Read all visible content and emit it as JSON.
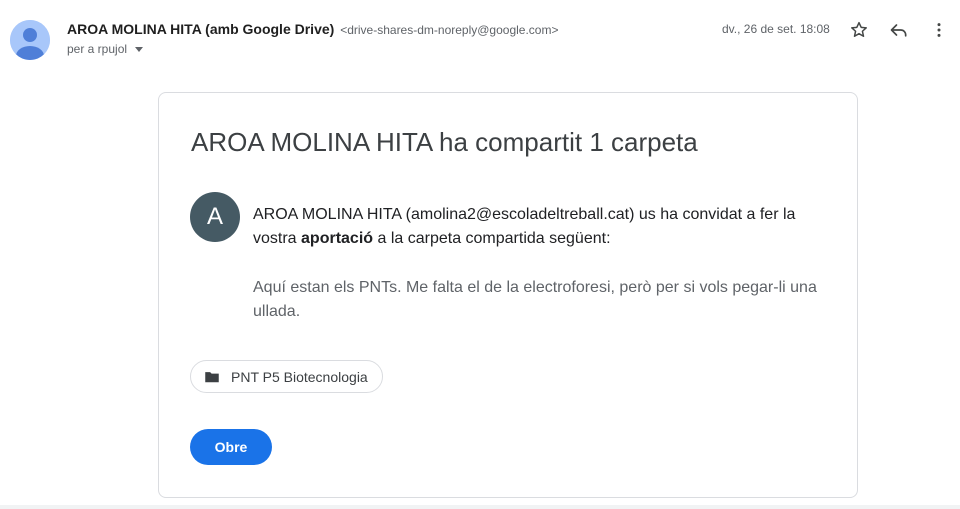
{
  "header": {
    "sender_name": "AROA MOLINA HITA (amb Google Drive)",
    "sender_email": "<drive-shares-dm-noreply@google.com>",
    "recipient": "per a rpujol",
    "date": "dv., 26 de set. 18:08",
    "icons": [
      "person-avatar-icon",
      "star-icon",
      "reply-icon",
      "more-vert-icon",
      "chevron-down-icon"
    ]
  },
  "card": {
    "title": "AROA MOLINA HITA ha compartit 1 carpeta",
    "avatar_initial": "A",
    "message_pre": "AROA MOLINA HITA (amolina2@escoladeltreball.cat) us ha convidat a fer la vostra ",
    "message_bold": "aportació",
    "message_post": " a la carpeta compartida següent:",
    "note": "Aquí estan els PNTs. Me falta el de la electroforesi, però per si vols pegar-li una ullada.",
    "folder_name": "PNT P5 Biotecnologia",
    "folder_icon": "folder-icon",
    "open_button": "Obre"
  },
  "colors": {
    "accent": "#1a73e8",
    "avatar_bg": "#455a64",
    "sender_avatar_bg": "#a8c7fa"
  }
}
